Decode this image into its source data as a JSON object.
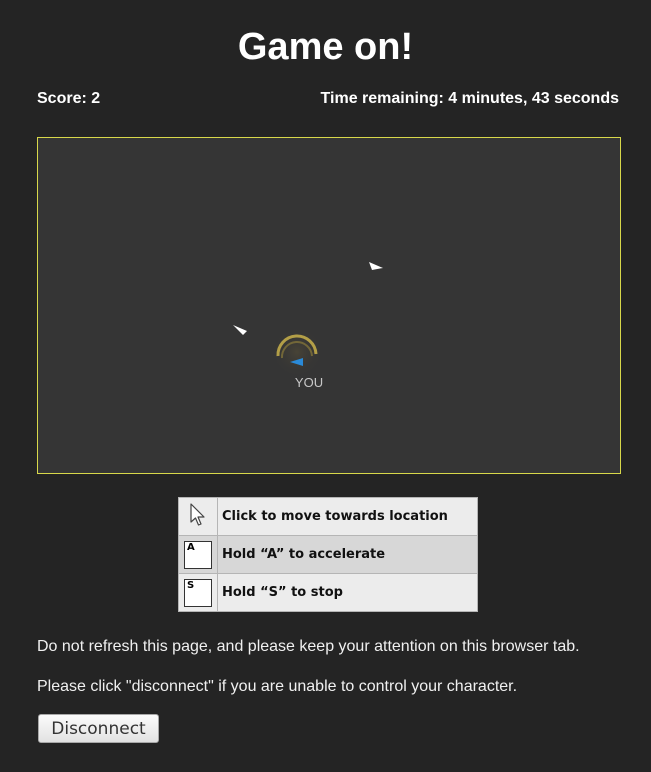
{
  "header": {
    "title": "Game on!"
  },
  "status": {
    "score_text": "Score: 2",
    "time_text": "Time remaining: 4 minutes, 43 seconds"
  },
  "game": {
    "player_label": "YOU",
    "colors": {
      "border": "#d8d84a",
      "field": "#353535",
      "player_arrow": "#2a8ad8",
      "player_ring": "#c9b24a",
      "others": "#ffffff"
    }
  },
  "controls": [
    {
      "icon": "mouse-cursor-icon",
      "label": "Click to move towards location"
    },
    {
      "icon": "a-key-icon",
      "key": "A",
      "label": "Hold “A” to accelerate"
    },
    {
      "icon": "s-key-icon",
      "key": "S",
      "label": "Hold “S” to stop"
    }
  ],
  "messages": {
    "refresh_note": "Do not refresh this page, and please keep your attention on this browser tab.",
    "disconnect_note": "Please click \"disconnect\" if you are unable to control your character."
  },
  "actions": {
    "disconnect_label": "Disconnect"
  }
}
